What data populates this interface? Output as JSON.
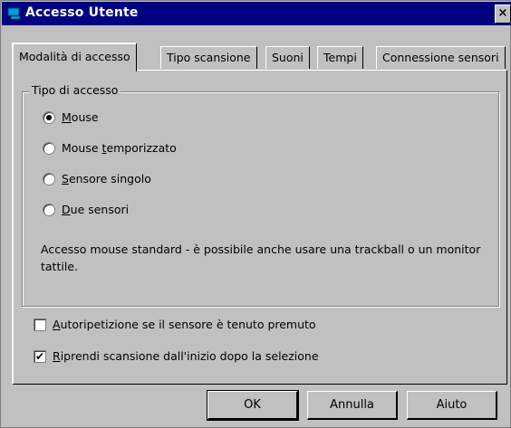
{
  "window": {
    "title": "Accesso Utente",
    "close_label": "×"
  },
  "tabs": [
    {
      "label": "Modalità di accesso",
      "active": true
    },
    {
      "label": "Tipo scansione",
      "active": false
    },
    {
      "label": "Suoni",
      "active": false
    },
    {
      "label": "Tempi",
      "active": false
    },
    {
      "label": "Connessione sensori",
      "active": false
    }
  ],
  "access_group": {
    "legend": "Tipo di accesso",
    "options": [
      {
        "mnemonic": "M",
        "rest": "ouse",
        "pre": "",
        "selected": true
      },
      {
        "pre": "Mouse ",
        "mnemonic": "t",
        "rest": "emporizzato",
        "selected": false
      },
      {
        "pre": "",
        "mnemonic": "S",
        "rest": "ensore singolo",
        "selected": false
      },
      {
        "pre": "",
        "mnemonic": "D",
        "rest": "ue sensori",
        "selected": false
      }
    ],
    "description": "Accesso mouse standard - è possibile anche usare una trackball o un monitor tattile."
  },
  "checkboxes": [
    {
      "mnemonic": "A",
      "rest": "utoripetizione se il sensore è tenuto premuto",
      "checked": false
    },
    {
      "mnemonic": "R",
      "rest": "iprendi scansione dall'inizio dopo la selezione",
      "checked": true
    }
  ],
  "buttons": {
    "ok": "OK",
    "cancel": "Annulla",
    "help": "Aiuto"
  }
}
